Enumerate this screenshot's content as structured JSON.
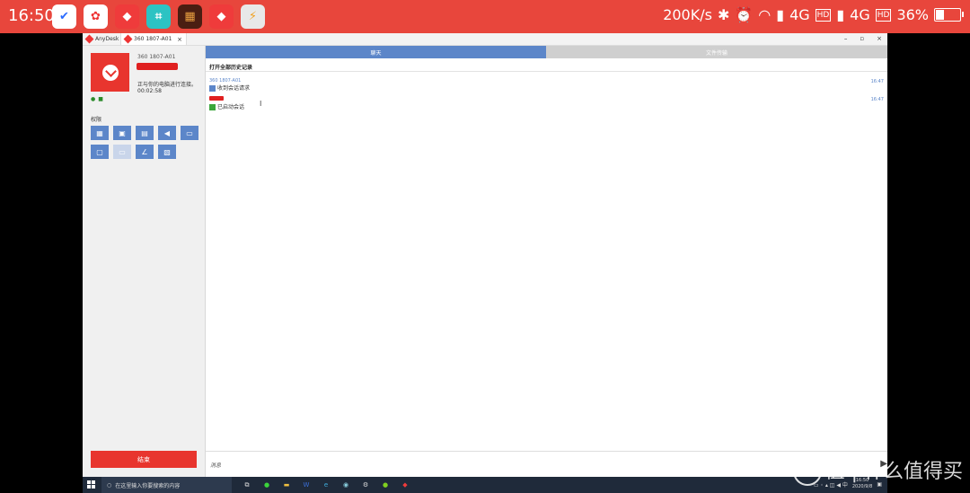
{
  "status_bar": {
    "time": "16:50",
    "net_speed": "200K/s",
    "signal1": "4G",
    "signal2": "4G",
    "hd": "HD",
    "battery": "36%",
    "battery_level": 0.36,
    "apps": [
      {
        "icon": "todo-app-icon",
        "color": "#ffffff",
        "fg": "#2b6bff",
        "glyph": "✔"
      },
      {
        "icon": "colorful-app-icon",
        "color": "#ffffff",
        "fg": "#e33",
        "glyph": "✿"
      },
      {
        "icon": "anydesk-app-icon",
        "color": "#ef3b3b",
        "fg": "#fff",
        "glyph": "◆"
      },
      {
        "icon": "scanner-app-icon",
        "color": "#2cc3c3",
        "fg": "#fff",
        "glyph": "⌗"
      },
      {
        "icon": "audio-app-icon",
        "color": "#4a1e12",
        "fg": "#e8a040",
        "glyph": "▦"
      },
      {
        "icon": "anydesk2-app-icon",
        "color": "#ef3b3b",
        "fg": "#fff",
        "glyph": "◆"
      },
      {
        "icon": "bolt-app-icon",
        "color": "#e8e8e8",
        "fg": "#f0a020",
        "glyph": "⚡"
      }
    ]
  },
  "window": {
    "tab1_label": "AnyDesk",
    "tab2_label": "360 1807-A01",
    "tab_close": "×",
    "minimize": "–",
    "maximize": "▫",
    "close": "×"
  },
  "sidebar": {
    "remote_id": "360 1807-A01",
    "connection_text": "正与你的电脑进行连接。",
    "timer": "00:02:58",
    "permissions_label": "权限",
    "end_button": "结束",
    "permission_buttons": [
      {
        "icon": "keyboard-mouse-icon",
        "glyph": "▦",
        "enabled": true
      },
      {
        "icon": "clipboard-icon",
        "glyph": "▣",
        "enabled": true
      },
      {
        "icon": "file-manager-icon",
        "glyph": "▤",
        "enabled": true
      },
      {
        "icon": "sound-icon",
        "glyph": "◀",
        "enabled": true
      },
      {
        "icon": "chat-icon",
        "glyph": "▭",
        "enabled": true
      },
      {
        "icon": "lock-screen-icon",
        "glyph": "▢",
        "enabled": true
      },
      {
        "icon": "block-input-icon",
        "glyph": "▭",
        "enabled": false
      },
      {
        "icon": "draw-icon",
        "glyph": "∠",
        "enabled": true
      },
      {
        "icon": "privacy-mode-icon",
        "glyph": "▧",
        "enabled": true
      }
    ]
  },
  "main": {
    "tab_chat": "聊天",
    "tab_file": "文件传输",
    "history_link": "打开全部历史记录",
    "messages": [
      {
        "sender": "360 1807-A01",
        "text": "收到会话请求",
        "time": "16:47"
      },
      {
        "sender": "",
        "text": "已启动会话",
        "time": "16:47"
      }
    ],
    "input_placeholder": "消息",
    "send_glyph": "▶"
  },
  "taskbar": {
    "search_placeholder": "在这里输入你要搜索的内容",
    "clock_time": "16:50",
    "clock_date": "2020/9/8",
    "apps": [
      {
        "icon": "task-view-icon",
        "glyph": "⧉",
        "color": "#ddd"
      },
      {
        "icon": "wechat-icon",
        "glyph": "●",
        "color": "#3bd43b"
      },
      {
        "icon": "explorer-icon",
        "glyph": "▬",
        "color": "#f0c040"
      },
      {
        "icon": "word-icon",
        "glyph": "W",
        "color": "#3a6fd8"
      },
      {
        "icon": "edge-icon",
        "glyph": "e",
        "color": "#3fb0e0"
      },
      {
        "icon": "browser-icon",
        "glyph": "◉",
        "color": "#8ad0e0"
      },
      {
        "icon": "settings-icon",
        "glyph": "⚙",
        "color": "#ddd"
      },
      {
        "icon": "green-app-icon",
        "glyph": "●",
        "color": "#80d020"
      },
      {
        "icon": "anydesk-taskbar-icon",
        "glyph": "◆",
        "color": "#ef3b3b"
      }
    ]
  },
  "watermark": "值 | 什么值得买"
}
